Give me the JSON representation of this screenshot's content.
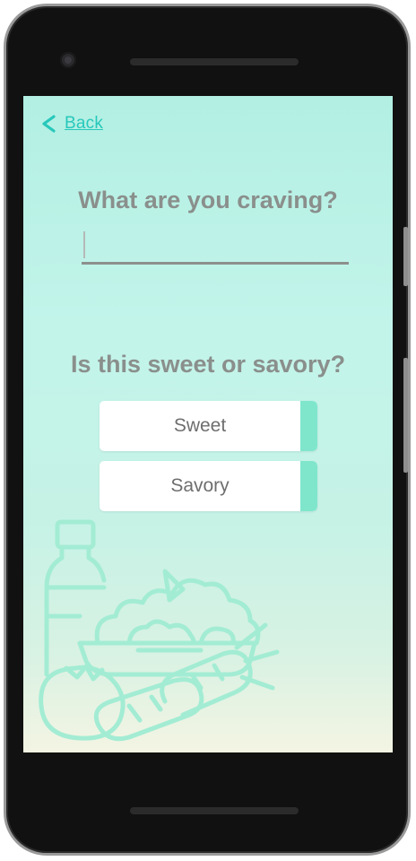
{
  "nav": {
    "back_label": "Back"
  },
  "form": {
    "craving_question": "What are you craving?",
    "craving_value": "",
    "type_question": "Is this sweet or savory?",
    "options": [
      {
        "label": "Sweet"
      },
      {
        "label": "Savory"
      }
    ]
  },
  "theme": {
    "accent": "#27c8bb",
    "button_accent": "#7fe6cc",
    "text_gray": "#8a8f8c",
    "illustration": "#a3ecd4"
  },
  "icons": {
    "back": "chevron-left-icon",
    "illustration": "groceries-illustration"
  }
}
